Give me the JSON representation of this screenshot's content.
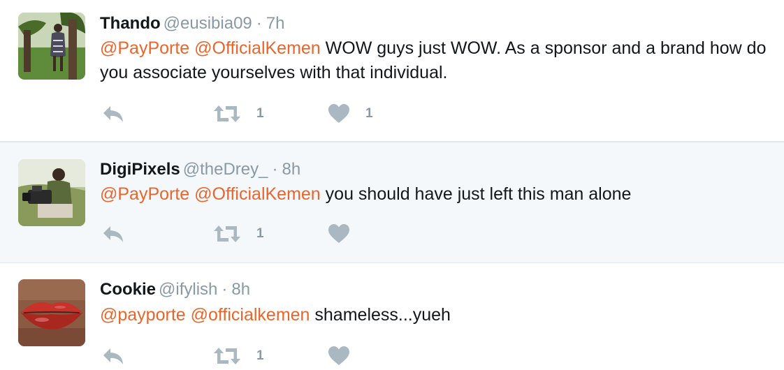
{
  "tweets": [
    {
      "name": "Thando",
      "handle": "@eusibia09",
      "separator": "·",
      "time": "7h",
      "mentions": [
        "@PayPorte",
        "@OfficialKemen"
      ],
      "text": "WOW guys just WOW. As a sponsor and a brand how do you associate yourselves with that individual.",
      "retweets": "1",
      "likes": "1",
      "avatar_icon": "woman-under-tree-photo"
    },
    {
      "name": "DigiPixels",
      "handle": "@theDrey_",
      "separator": "·",
      "time": "8h",
      "mentions": [
        "@PayPorte",
        "@OfficialKemen"
      ],
      "text": "you should have just left this man alone",
      "retweets": "1",
      "likes": "",
      "avatar_icon": "man-with-camera-photo"
    },
    {
      "name": "Cookie",
      "handle": "@ifylish",
      "separator": "·",
      "time": "8h",
      "mentions": [
        "@payporte",
        "@officialkemen"
      ],
      "text": "shameless...yueh",
      "retweets": "1",
      "likes": "",
      "avatar_icon": "red-lips-photo"
    }
  ],
  "colors": {
    "mention": "#e8662c",
    "muted": "#8899a6",
    "icon": "#aab8c2",
    "highlight_bg": "#f5f8fa"
  }
}
